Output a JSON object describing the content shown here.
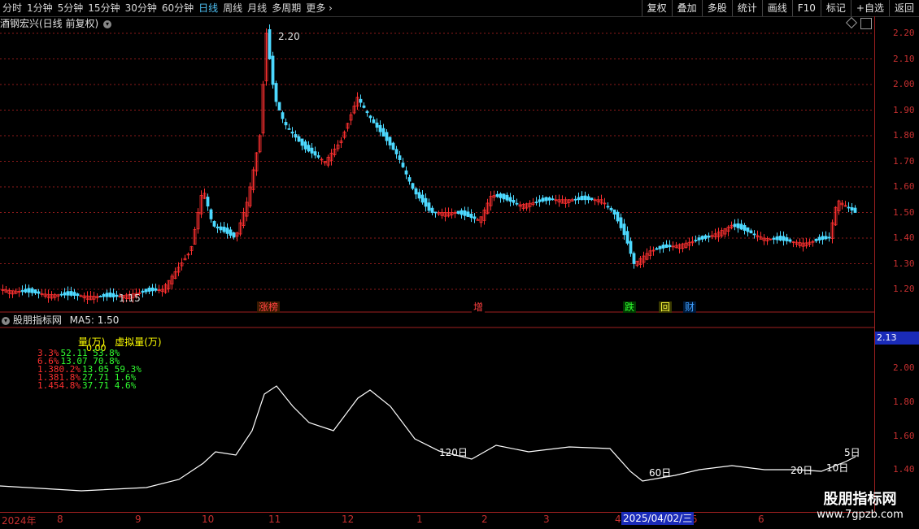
{
  "toolbar": {
    "timeframes": [
      "分时",
      "1分钟",
      "5分钟",
      "15分钟",
      "30分钟",
      "60分钟",
      "日线",
      "周线",
      "月线",
      "多周期"
    ],
    "active": "日线",
    "more_label": "更多",
    "right_buttons": [
      "复权",
      "叠加",
      "多股",
      "统计",
      "画线",
      "F10",
      "标记",
      "+自选",
      "返回"
    ]
  },
  "main_chart": {
    "title": "酒钢宏兴(日线 前复权)",
    "high_label": "2.20",
    "low_label": "1.15",
    "y_ticks": [
      "2.20",
      "2.10",
      "2.00",
      "1.90",
      "1.80",
      "1.70",
      "1.60",
      "1.50",
      "1.40",
      "1.30",
      "1.20"
    ],
    "markers": [
      {
        "label": "涨榜",
        "color": "#ff4040",
        "bg": "#3a1a00"
      },
      {
        "label": "增",
        "color": "#ff4040",
        "bg": "#000"
      },
      {
        "label": "跌",
        "color": "#30ff30",
        "bg": "#003a00"
      },
      {
        "label": "回",
        "color": "#ffff40",
        "bg": "#3a3a00"
      },
      {
        "label": "财",
        "color": "#40a0ff",
        "bg": "#001a3a"
      }
    ]
  },
  "indicator": {
    "name": "股朋指标网",
    "ma_text": "MA5: 1.50",
    "legend": [
      "量(万)",
      "虚拟量(万)"
    ],
    "legend_sub": "0.00",
    "stats": [
      {
        "left": "3.3%",
        "right": "52.11 53.8%"
      },
      {
        "left": "6.6%",
        "right": "13.07 70.8%"
      },
      {
        "left": "1.380.2%",
        "right": "13.05 59.3%"
      },
      {
        "left": "1.381.8%",
        "right": "27.71 1.6%"
      },
      {
        "left": "1.454.8%",
        "right": "37.71 4.6%"
      }
    ],
    "current_value": "2.13",
    "y_ticks": [
      "2.00",
      "1.80",
      "1.60",
      "1.40"
    ],
    "ma_labels": [
      "120日",
      "60日",
      "20日",
      "10日",
      "5日"
    ]
  },
  "date_axis": {
    "labels": [
      "2024年",
      "8",
      "9",
      "10",
      "11",
      "12",
      "1",
      "2",
      "3",
      "4",
      "5",
      "6"
    ],
    "cursor_date": "2025/04/02/三"
  },
  "watermark": {
    "title": "股朋指标网",
    "url": "www.7gpzb.com"
  },
  "colors": {
    "up": "#ff3030",
    "down": "#4dd9ff",
    "axis": "#c83030",
    "grid": "#8b1a1a",
    "line": "#ffffff"
  },
  "icons": [
    "circle-expand-icon",
    "diamond-icon",
    "collapse-icon"
  ]
}
